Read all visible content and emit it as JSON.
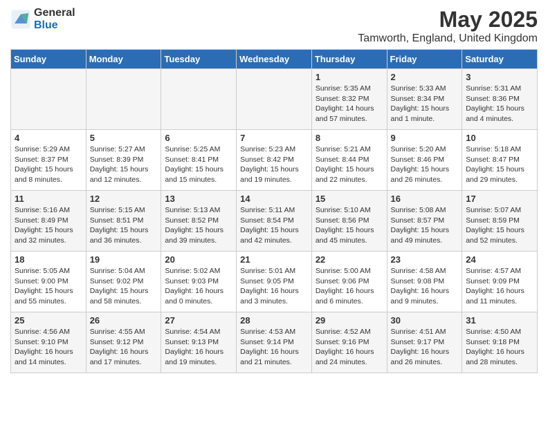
{
  "header": {
    "logo_general": "General",
    "logo_blue": "Blue",
    "title": "May 2025",
    "subtitle": "Tamworth, England, United Kingdom"
  },
  "weekdays": [
    "Sunday",
    "Monday",
    "Tuesday",
    "Wednesday",
    "Thursday",
    "Friday",
    "Saturday"
  ],
  "weeks": [
    [
      {
        "day": "",
        "info": ""
      },
      {
        "day": "",
        "info": ""
      },
      {
        "day": "",
        "info": ""
      },
      {
        "day": "",
        "info": ""
      },
      {
        "day": "1",
        "info": "Sunrise: 5:35 AM\nSunset: 8:32 PM\nDaylight: 14 hours\nand 57 minutes."
      },
      {
        "day": "2",
        "info": "Sunrise: 5:33 AM\nSunset: 8:34 PM\nDaylight: 15 hours\nand 1 minute."
      },
      {
        "day": "3",
        "info": "Sunrise: 5:31 AM\nSunset: 8:36 PM\nDaylight: 15 hours\nand 4 minutes."
      }
    ],
    [
      {
        "day": "4",
        "info": "Sunrise: 5:29 AM\nSunset: 8:37 PM\nDaylight: 15 hours\nand 8 minutes."
      },
      {
        "day": "5",
        "info": "Sunrise: 5:27 AM\nSunset: 8:39 PM\nDaylight: 15 hours\nand 12 minutes."
      },
      {
        "day": "6",
        "info": "Sunrise: 5:25 AM\nSunset: 8:41 PM\nDaylight: 15 hours\nand 15 minutes."
      },
      {
        "day": "7",
        "info": "Sunrise: 5:23 AM\nSunset: 8:42 PM\nDaylight: 15 hours\nand 19 minutes."
      },
      {
        "day": "8",
        "info": "Sunrise: 5:21 AM\nSunset: 8:44 PM\nDaylight: 15 hours\nand 22 minutes."
      },
      {
        "day": "9",
        "info": "Sunrise: 5:20 AM\nSunset: 8:46 PM\nDaylight: 15 hours\nand 26 minutes."
      },
      {
        "day": "10",
        "info": "Sunrise: 5:18 AM\nSunset: 8:47 PM\nDaylight: 15 hours\nand 29 minutes."
      }
    ],
    [
      {
        "day": "11",
        "info": "Sunrise: 5:16 AM\nSunset: 8:49 PM\nDaylight: 15 hours\nand 32 minutes."
      },
      {
        "day": "12",
        "info": "Sunrise: 5:15 AM\nSunset: 8:51 PM\nDaylight: 15 hours\nand 36 minutes."
      },
      {
        "day": "13",
        "info": "Sunrise: 5:13 AM\nSunset: 8:52 PM\nDaylight: 15 hours\nand 39 minutes."
      },
      {
        "day": "14",
        "info": "Sunrise: 5:11 AM\nSunset: 8:54 PM\nDaylight: 15 hours\nand 42 minutes."
      },
      {
        "day": "15",
        "info": "Sunrise: 5:10 AM\nSunset: 8:56 PM\nDaylight: 15 hours\nand 45 minutes."
      },
      {
        "day": "16",
        "info": "Sunrise: 5:08 AM\nSunset: 8:57 PM\nDaylight: 15 hours\nand 49 minutes."
      },
      {
        "day": "17",
        "info": "Sunrise: 5:07 AM\nSunset: 8:59 PM\nDaylight: 15 hours\nand 52 minutes."
      }
    ],
    [
      {
        "day": "18",
        "info": "Sunrise: 5:05 AM\nSunset: 9:00 PM\nDaylight: 15 hours\nand 55 minutes."
      },
      {
        "day": "19",
        "info": "Sunrise: 5:04 AM\nSunset: 9:02 PM\nDaylight: 15 hours\nand 58 minutes."
      },
      {
        "day": "20",
        "info": "Sunrise: 5:02 AM\nSunset: 9:03 PM\nDaylight: 16 hours\nand 0 minutes."
      },
      {
        "day": "21",
        "info": "Sunrise: 5:01 AM\nSunset: 9:05 PM\nDaylight: 16 hours\nand 3 minutes."
      },
      {
        "day": "22",
        "info": "Sunrise: 5:00 AM\nSunset: 9:06 PM\nDaylight: 16 hours\nand 6 minutes."
      },
      {
        "day": "23",
        "info": "Sunrise: 4:58 AM\nSunset: 9:08 PM\nDaylight: 16 hours\nand 9 minutes."
      },
      {
        "day": "24",
        "info": "Sunrise: 4:57 AM\nSunset: 9:09 PM\nDaylight: 16 hours\nand 11 minutes."
      }
    ],
    [
      {
        "day": "25",
        "info": "Sunrise: 4:56 AM\nSunset: 9:10 PM\nDaylight: 16 hours\nand 14 minutes."
      },
      {
        "day": "26",
        "info": "Sunrise: 4:55 AM\nSunset: 9:12 PM\nDaylight: 16 hours\nand 17 minutes."
      },
      {
        "day": "27",
        "info": "Sunrise: 4:54 AM\nSunset: 9:13 PM\nDaylight: 16 hours\nand 19 minutes."
      },
      {
        "day": "28",
        "info": "Sunrise: 4:53 AM\nSunset: 9:14 PM\nDaylight: 16 hours\nand 21 minutes."
      },
      {
        "day": "29",
        "info": "Sunrise: 4:52 AM\nSunset: 9:16 PM\nDaylight: 16 hours\nand 24 minutes."
      },
      {
        "day": "30",
        "info": "Sunrise: 4:51 AM\nSunset: 9:17 PM\nDaylight: 16 hours\nand 26 minutes."
      },
      {
        "day": "31",
        "info": "Sunrise: 4:50 AM\nSunset: 9:18 PM\nDaylight: 16 hours\nand 28 minutes."
      }
    ]
  ]
}
